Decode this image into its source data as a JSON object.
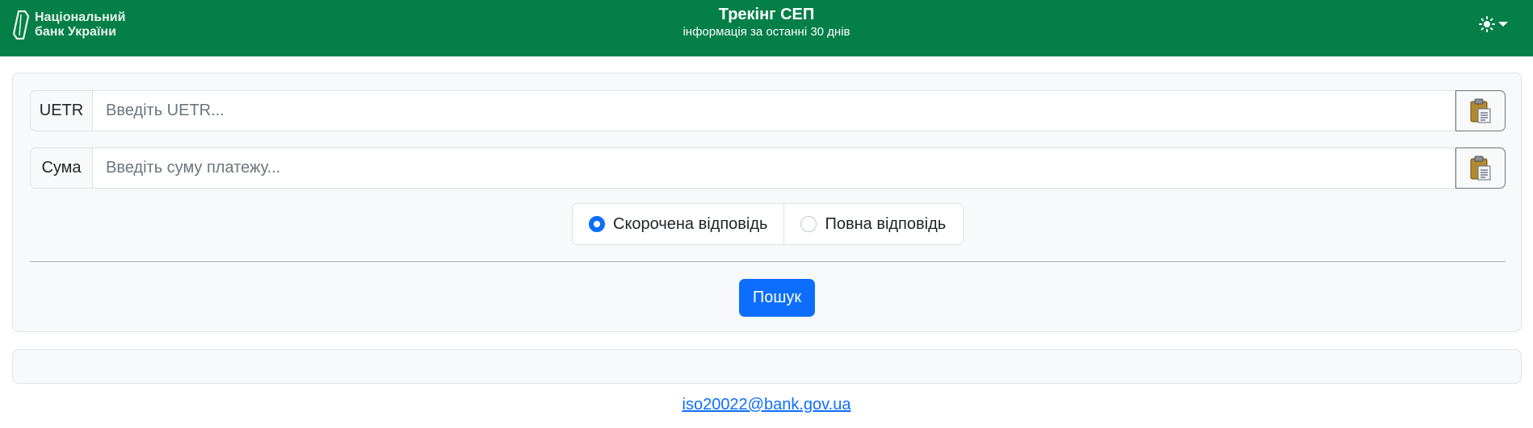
{
  "header": {
    "logo_text": "Національний\nбанк України",
    "title": "Трекінг СЕП",
    "subtitle": "інформація за останні 30 днів",
    "theme_icon": "sun-icon",
    "colors": {
      "navbar": "#037f47",
      "primary": "#0d6efd"
    }
  },
  "form": {
    "uetr": {
      "label": "UETR",
      "value": "",
      "placeholder": "Введіть UETR...",
      "paste_icon": "clipboard-icon"
    },
    "amount": {
      "label": "Сума",
      "value": "",
      "placeholder": "Введіть суму платежу...",
      "paste_icon": "clipboard-icon"
    },
    "response_mode": {
      "selected": "short",
      "options": [
        {
          "id": "short",
          "label": "Скорочена відповідь"
        },
        {
          "id": "full",
          "label": "Повна відповідь"
        }
      ]
    },
    "search_label": "Пошук"
  },
  "footer": {
    "email": "iso20022@bank.gov.ua"
  }
}
